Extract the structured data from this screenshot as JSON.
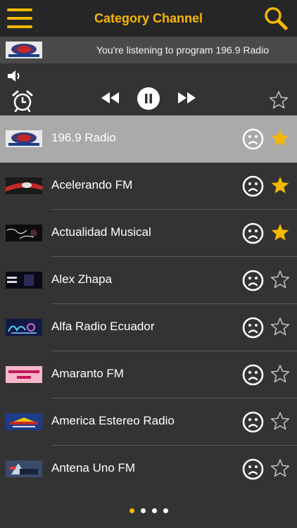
{
  "header": {
    "title": "Category Channel"
  },
  "now_playing": {
    "text": "You're listening to program 196.9 Radio"
  },
  "colors": {
    "accent": "#F5B800",
    "selected_row": "#aaaaaa",
    "background": "#333333"
  },
  "stations": [
    {
      "name": "196.9 Radio",
      "favorite": true,
      "selected": true,
      "logo": "196.9 radio logo"
    },
    {
      "name": "Acelerando FM",
      "favorite": true,
      "selected": false,
      "logo": "acelerando fm logo"
    },
    {
      "name": "Actualidad Musical",
      "favorite": true,
      "selected": false,
      "logo": "actualidad musical logo"
    },
    {
      "name": "Alex Zhapa",
      "favorite": false,
      "selected": false,
      "logo": "alex zhapa logo"
    },
    {
      "name": "Alfa Radio Ecuador",
      "favorite": false,
      "selected": false,
      "logo": "alfa radio logo"
    },
    {
      "name": "Amaranto FM",
      "favorite": false,
      "selected": false,
      "logo": "amaranto fm logo"
    },
    {
      "name": "America Estereo Radio",
      "favorite": false,
      "selected": false,
      "logo": "america estereo logo"
    },
    {
      "name": "Antena Uno FM",
      "favorite": false,
      "selected": false,
      "logo": "antena uno logo"
    }
  ],
  "pagination": {
    "pages": 4,
    "current": 1
  }
}
